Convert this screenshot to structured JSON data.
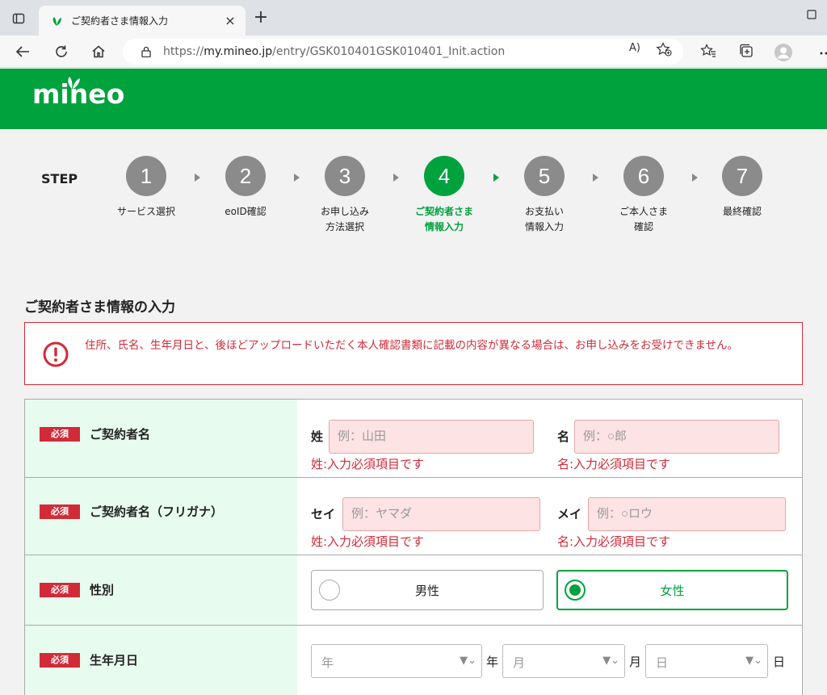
{
  "browser": {
    "tab_title": "ご契約者さま情報入力",
    "tab_close": "×",
    "new_tab": "+",
    "url_prefix": "https://",
    "url_host": "my.mineo.jp",
    "url_path": "/entry/GSK010401GSK010401_Init.action",
    "read_aloud": "A)"
  },
  "site": {
    "logo": "mineo",
    "brand_color": "#00a23e"
  },
  "stepper": {
    "label": "STEP",
    "steps": [
      {
        "num": "1",
        "caption": "サービス選択"
      },
      {
        "num": "2",
        "caption": "eoID確認"
      },
      {
        "num": "3",
        "caption": "お申し込み\n方法選択"
      },
      {
        "num": "4",
        "caption": "ご契約者さま\n情報入力"
      },
      {
        "num": "5",
        "caption": "お支払い\n情報入力"
      },
      {
        "num": "6",
        "caption": "ご本人さま\n確認"
      },
      {
        "num": "7",
        "caption": "最終確認"
      }
    ],
    "active_step": 4
  },
  "section": {
    "title": "ご契約者さま情報の入力",
    "alert": "住所、氏名、生年月日と、後ほどアップロードいただく本人確認書類に記載の内容が異なる場合は、お申し込みをお受けできません。"
  },
  "form": {
    "required_badge": "必須",
    "name": {
      "label": "ご契約者名",
      "last_label": "姓",
      "last_placeholder": "例：山田",
      "last_error": "姓:入力必須項目です",
      "first_label": "名",
      "first_placeholder": "例：○郎",
      "first_error": "名:入力必須項目です"
    },
    "kana": {
      "label": "ご契約者名（フリガナ）",
      "last_label": "セイ",
      "last_placeholder": "例：ヤマダ",
      "last_error": "姓:入力必須項目です",
      "first_label": "メイ",
      "first_placeholder": "例：○ロウ",
      "first_error": "名:入力必須項目です"
    },
    "gender": {
      "label": "性別",
      "options": [
        "男性",
        "女性"
      ],
      "selected": "女性"
    },
    "birthdate": {
      "label": "生年月日",
      "year_placeholder": "年",
      "year_unit": "年",
      "month_placeholder": "月",
      "month_unit": "月",
      "day_placeholder": "日",
      "day_unit": "日"
    }
  }
}
